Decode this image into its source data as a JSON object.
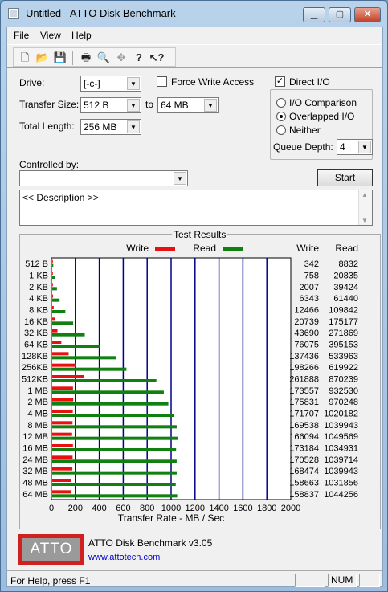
{
  "window": {
    "title": "Untitled - ATTO Disk Benchmark",
    "minimize": "▁",
    "maximize": "▢",
    "close": "✕"
  },
  "menu": [
    "File",
    "View",
    "Help"
  ],
  "toolbar": [
    "new-icon",
    "open-icon",
    "save-icon",
    "print-icon",
    "print-preview-icon",
    "move-icon",
    "help-icon",
    "context-help-icon"
  ],
  "form": {
    "drive_label": "Drive:",
    "drive_value": "[-c-]",
    "force_write_label": "Force Write Access",
    "force_write_checked": false,
    "direct_io_label": "Direct I/O",
    "direct_io_checked": true,
    "transfer_size_label": "Transfer Size:",
    "transfer_from": "512 B",
    "to_label": "to",
    "transfer_to": "64 MB",
    "total_length_label": "Total Length:",
    "total_length": "256 MB",
    "io_comparison_label": "I/O Comparison",
    "overlapped_io_label": "Overlapped I/O",
    "neither_label": "Neither",
    "selected_mode": "Overlapped I/O",
    "queue_depth_label": "Queue Depth:",
    "queue_depth": "4",
    "controlled_by_label": "Controlled by:",
    "controlled_by_value": "",
    "start_label": "Start",
    "description": "<< Description >>"
  },
  "chart_data": {
    "type": "bar",
    "title": "Test Results",
    "xlabel": "Transfer Rate - MB / Sec",
    "xlim": [
      0,
      2000
    ],
    "xticks": [
      0,
      200,
      400,
      600,
      800,
      1000,
      1200,
      1400,
      1600,
      1800,
      2000
    ],
    "legend": {
      "write": "Write",
      "read": "Read",
      "placement": "top"
    },
    "columns": {
      "write": "Write",
      "read": "Read"
    },
    "colors": {
      "write": "#e81010",
      "read": "#108010",
      "grid": "#00008b"
    },
    "categories": [
      "512 B",
      "1 KB",
      "2 KB",
      "4 KB",
      "8 KB",
      "16 KB",
      "32 KB",
      "64 KB",
      "128KB",
      "256KB",
      "512KB",
      "1 MB",
      "2 MB",
      "4 MB",
      "8 MB",
      "12 MB",
      "16 MB",
      "24 MB",
      "32 MB",
      "48 MB",
      "64 MB"
    ],
    "series": [
      {
        "name": "Write",
        "values": [
          342,
          758,
          2007,
          6343,
          12466,
          20739,
          43690,
          76075,
          137436,
          198266,
          261888,
          173557,
          175831,
          171707,
          169538,
          166094,
          173184,
          170528,
          168474,
          158663,
          158837
        ]
      },
      {
        "name": "Read",
        "values": [
          8832,
          20835,
          39424,
          61440,
          109842,
          175177,
          271869,
          395153,
          533963,
          619922,
          870239,
          932530,
          970248,
          1020182,
          1039943,
          1049569,
          1034931,
          1039714,
          1039943,
          1031856,
          1044256
        ]
      }
    ],
    "value_unit_divisor": 1000
  },
  "footer": {
    "logo": "ATTO",
    "version": "ATTO Disk Benchmark v3.05",
    "url": "www.attotech.com"
  },
  "status": {
    "text": "For Help, press F1",
    "num": "NUM"
  }
}
